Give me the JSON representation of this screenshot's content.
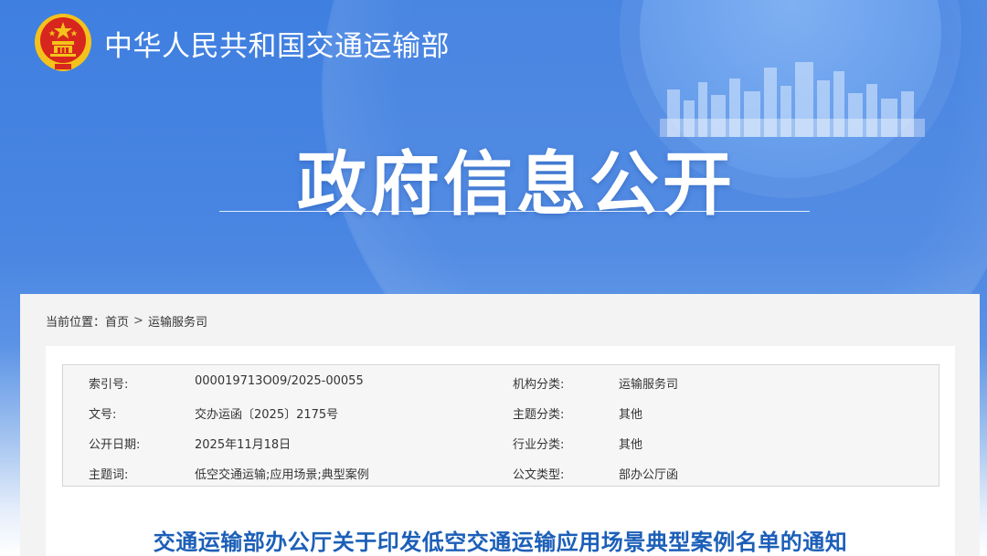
{
  "header": {
    "agency_name": "中华人民共和国交通运输部",
    "page_title": "政府信息公开"
  },
  "breadcrumb": {
    "label": "当前位置：",
    "home": "首页",
    "separator": ">",
    "current": "运输服务司"
  },
  "metadata": {
    "rows": [
      {
        "key1": "索引号:",
        "value1": "000019713O09/2025-00055",
        "key2": "机构分类:",
        "value2": "运输服务司"
      },
      {
        "key1": "文号:",
        "value1": "交办运函〔2025〕2175号",
        "key2": "主题分类:",
        "value2": "其他"
      },
      {
        "key1": "公开日期:",
        "value1": "2025年11月18日",
        "key2": "行业分类:",
        "value2": "其他"
      },
      {
        "key1": "主题词:",
        "value1": "低空交通运输;应用场景;典型案例",
        "key2": "公文类型:",
        "value2": "部办公厅函"
      }
    ]
  },
  "document": {
    "title": "交通运输部办公厅关于印发低空交通运输应用场景典型案例名单的通知"
  },
  "colors": {
    "banner_blue": "#4a86e2",
    "title_blue": "#1c5fb8",
    "emblem_red": "#d7261e",
    "emblem_gold": "#f4c21b"
  },
  "icons": {
    "emblem": "national-emblem-icon",
    "city": "city-skyline-icon"
  }
}
